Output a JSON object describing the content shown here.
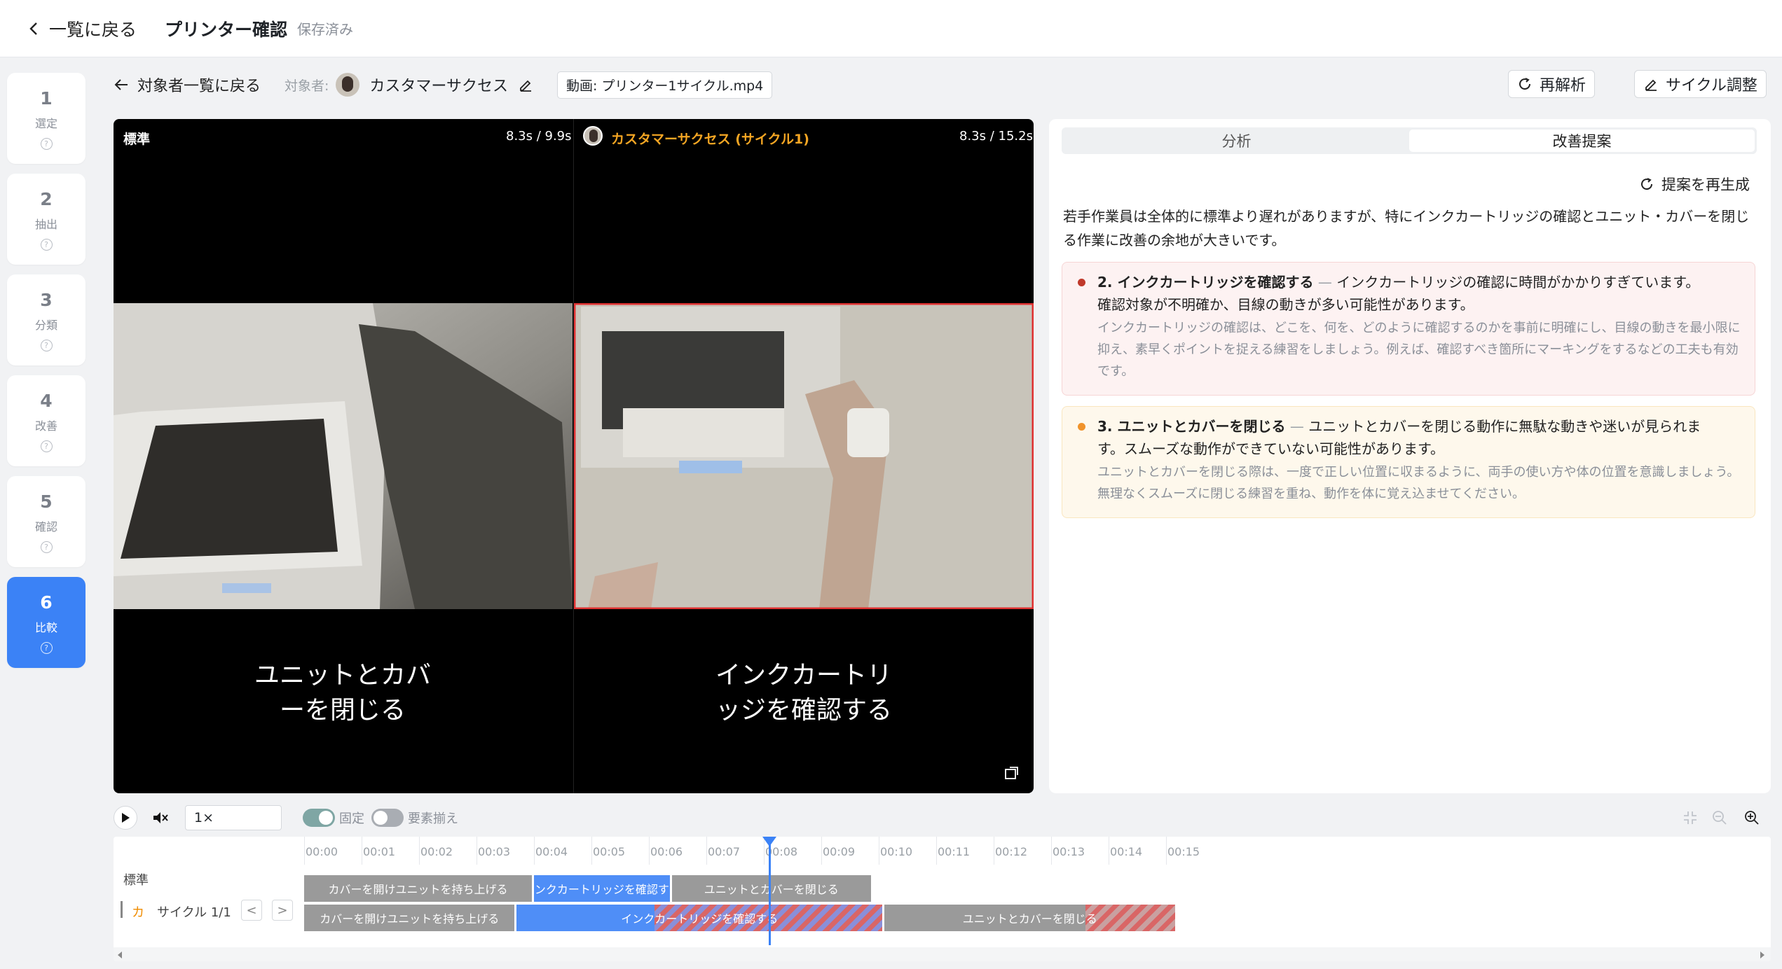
{
  "header": {
    "back_label": "一覧に戻る",
    "title": "プリンター確認",
    "status": "保存済み"
  },
  "steps": [
    {
      "num": "1",
      "label": "選定"
    },
    {
      "num": "2",
      "label": "抽出"
    },
    {
      "num": "3",
      "label": "分類"
    },
    {
      "num": "4",
      "label": "改善"
    },
    {
      "num": "5",
      "label": "確認"
    },
    {
      "num": "6",
      "label": "比較"
    }
  ],
  "active_step": 6,
  "subbar": {
    "back_label": "対象者一覧に戻る",
    "target_prefix": "対象者:",
    "target_name": "カスタマーサクセス",
    "video_file": "動画: プリンター1サイクル.mp4",
    "reanalyze_label": "再解析",
    "cycle_adjust_label": "サイクル調整"
  },
  "video": {
    "left": {
      "label": "標準",
      "time": "8.3s / 9.9s",
      "caption_line1": "ユニットとカバ",
      "caption_line2": "ーを閉じる"
    },
    "right": {
      "label": "カスタマーサクセス (サイクル1)",
      "time": "8.3s / 15.2s",
      "caption_line1": "インクカートリ",
      "caption_line2": "ッジを確認する"
    }
  },
  "panel": {
    "tabs": [
      "分析",
      "改善提案"
    ],
    "active_tab": "改善提案",
    "regen_label": "提案を再生成",
    "summary": "若手作業員は全体的に標準より遅れがありますが、特にインクカートリッジの確認とユニット・カバーを閉じる作業に改善の余地が大きいです。",
    "suggestions": [
      {
        "title": "2. インクカートリッジを確認する",
        "issue_line1": "インクカートリッジの確認に時間がかかりすぎています。",
        "issue_line2": "確認対象が不明確か、目線の動きが多い可能性があります。",
        "advice": "インクカートリッジの確認は、どこを、何を、どのように確認するのかを事前に明確にし、目線の動きを最小限に抑え、素早くポイントを捉える練習をしましょう。例えば、確認すべき箇所にマーキングをするなどの工夫も有効です。",
        "color": "#c0392b"
      },
      {
        "title": "3. ユニットとカバーを閉じる",
        "issue_line1": "ユニットとカバーを閉じる動作に無駄な動きや迷いが見られま",
        "issue_line2": "す。スムーズな動作ができていない可能性があります。",
        "advice": "ユニットとカバーを閉じる際は、一度で正しい位置に収まるように、両手の使い方や体の位置を意識しましょう。無理なくスムーズに閉じる練習を重ね、動作を体に覚え込ませてください。",
        "color": "#f0932b"
      }
    ]
  },
  "controls": {
    "speed": "1×",
    "fixed_label": "固定",
    "align_label": "要素揃え",
    "fixed_on": true,
    "align_on": false
  },
  "timeline": {
    "ticks": [
      "00:00",
      "00:01",
      "00:02",
      "00:03",
      "00:04",
      "00:05",
      "00:06",
      "00:07",
      "00:08",
      "00:09",
      "00:10",
      "00:11",
      "00:12",
      "00:13",
      "00:14",
      "00:15"
    ],
    "playhead_sec": 8.1,
    "rows": [
      {
        "label": "標準",
        "segments": [
          {
            "label": "カバーを開けユニットを持ち上げる",
            "start": 0,
            "end": 4.0,
            "color": "gray"
          },
          {
            "label": "インクカートリッジを確認する",
            "start": 4.0,
            "end": 6.4,
            "color": "blue"
          },
          {
            "label": "ユニットとカバーを閉じる",
            "start": 6.4,
            "end": 9.9,
            "color": "gray"
          }
        ]
      },
      {
        "label": "サイクル 1/1",
        "prefix": "カ",
        "segments": [
          {
            "label": "カバーを開けユニットを持ち上げる",
            "start": 0,
            "end": 3.7,
            "color": "gray"
          },
          {
            "label": "インクカートリッジを確認する",
            "start": 3.7,
            "end": 10.1,
            "color": "blue",
            "overrun_from": 6.1
          },
          {
            "label": "ユニットとカバーを閉じる",
            "start": 10.1,
            "end": 15.2,
            "color": "gray",
            "overrun_from": 13.6
          }
        ]
      }
    ]
  }
}
